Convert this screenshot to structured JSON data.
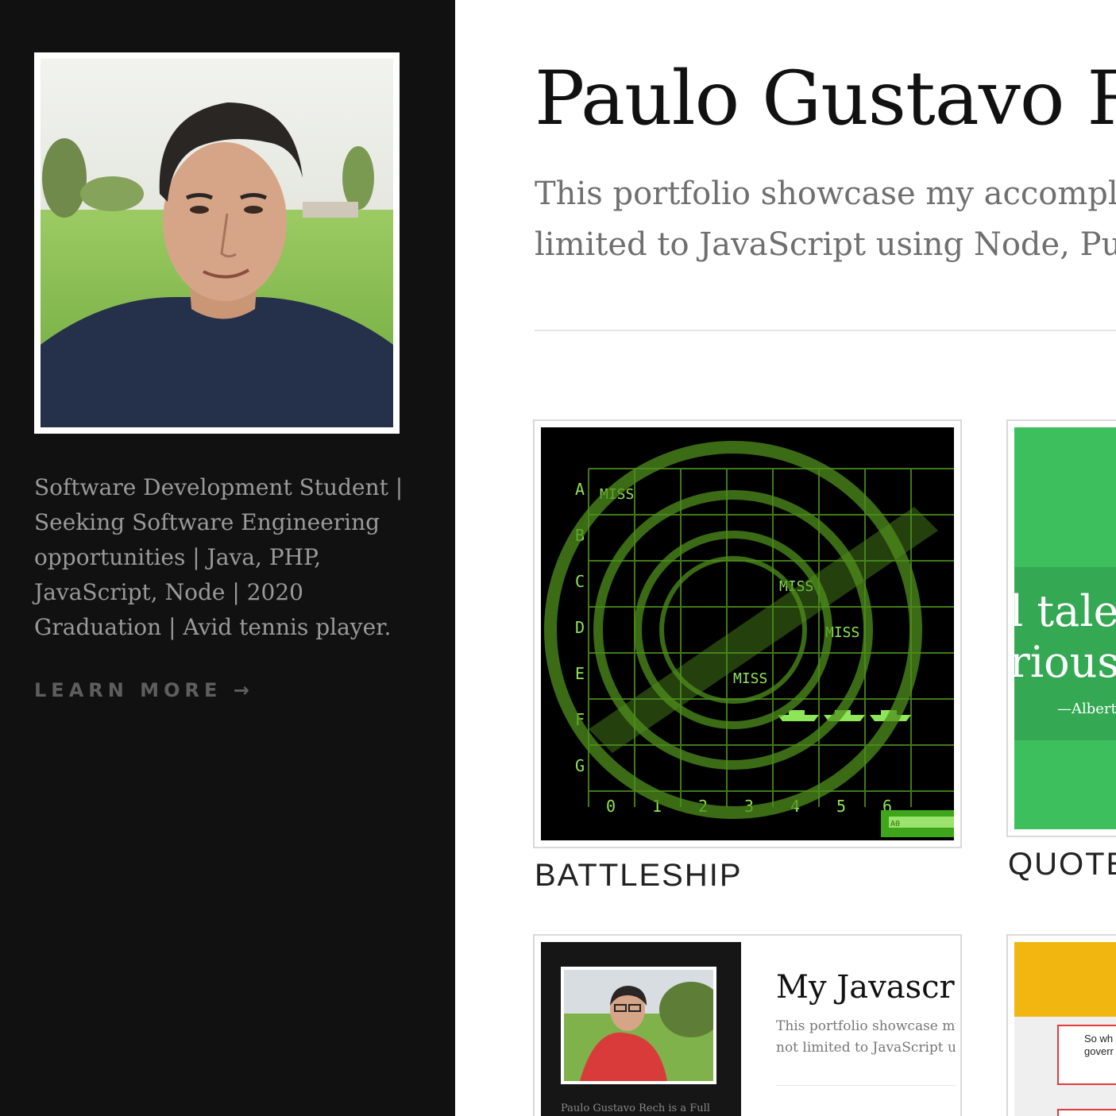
{
  "sidebar": {
    "bio": "Software Development Student | Seeking Software Engineering opportunities | Java, PHP, JavaScript, Node | 2020 Graduation | Avid tennis player.",
    "learn_more": "LEARN MORE →"
  },
  "header": {
    "title": "Paulo Gustavo Rech",
    "intro_line1": "This portfolio showcase my accomplishments in development, including but not",
    "intro_line2": "limited to JavaScript using Node, Pug, Express and more."
  },
  "projects": [
    {
      "title": "BATTLESHIP",
      "rows": [
        "A",
        "B",
        "C",
        "D",
        "E",
        "F",
        "G"
      ],
      "cols": [
        "0",
        "1",
        "2",
        "3",
        "4",
        "5",
        "6"
      ],
      "miss_label": "MISS",
      "input_label": "A0"
    },
    {
      "title": "QUOTE",
      "quote_line1": "l talen",
      "quote_line2": "rious.",
      "author": "—Albert"
    },
    {
      "title": "",
      "heading": "My Javascri",
      "text_line1": "This portfolio showcase my",
      "text_line2": "not limited to JavaScript us",
      "caption": "Paulo Gustavo Rech is a Full"
    },
    {
      "title": "",
      "box_line1": "So wh",
      "box_line2": "goverr"
    }
  ],
  "colors": {
    "sidebar_bg": "#111111",
    "radar_green": "#7fe33a",
    "quote_green": "#3dbf5e",
    "yellow": "#f1b60f"
  }
}
